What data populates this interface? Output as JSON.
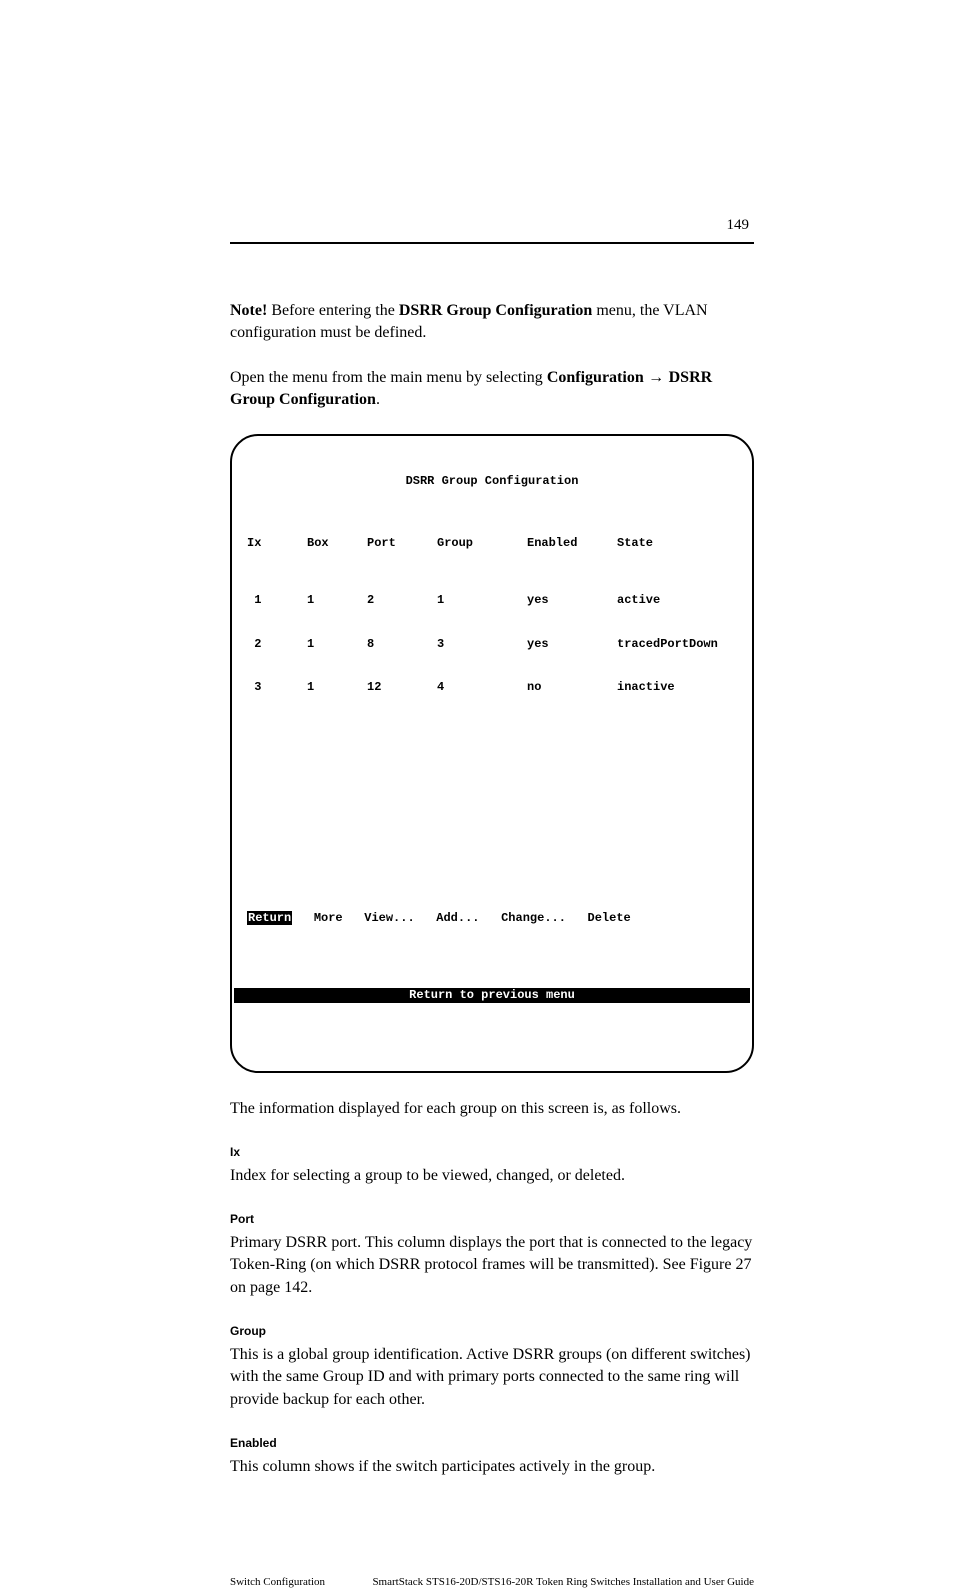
{
  "page_number": "149",
  "intro": {
    "note_label": "Note!",
    "note_pre": " Before entering the ",
    "note_bold": "DSRR Group Configuration",
    "note_post": " menu, the VLAN configuration must be defined."
  },
  "open_menu": {
    "pre": "Open the menu from the main menu by selecting ",
    "b1": "Configuration",
    "arrow": " → ",
    "b2": "DSRR Group Configuration",
    "post": "."
  },
  "terminal": {
    "title": "DSRR Group Configuration",
    "headers": {
      "ix": "Ix",
      "box": "Box",
      "port": "Port",
      "group": "Group",
      "enabled": "Enabled",
      "state": "State"
    },
    "rows": [
      {
        "ix": " 1",
        "box": "1",
        "port": "2",
        "group": "1",
        "enabled": "yes",
        "state": "active"
      },
      {
        "ix": " 2",
        "box": "1",
        "port": "8",
        "group": "3",
        "enabled": "yes",
        "state": "tracedPortDown"
      },
      {
        "ix": " 3",
        "box": "1",
        "port": "12",
        "group": "4",
        "enabled": "no",
        "state": "inactive"
      }
    ],
    "actions": {
      "return": "Return",
      "more": "More",
      "view": "View...",
      "add": "Add...",
      "change": "Change...",
      "delete": "Delete"
    },
    "status": "Return to previous menu"
  },
  "para_after": "The information displayed for each group on this screen is, as follows.",
  "sections": {
    "ix": {
      "heading": "Ix",
      "text": "Index for selecting a group to be viewed, changed, or deleted."
    },
    "port": {
      "heading": "Port",
      "text": "Primary DSRR port. This column displays the port that is connected to the legacy Token-Ring (on which DSRR protocol frames will be transmitted). See Figure 27 on page 142."
    },
    "group": {
      "heading": "Group",
      "text": "This is a global group identification. Active DSRR groups (on different switches) with the same Group ID and with primary ports connected to the same ring will provide backup for each other."
    },
    "enabled": {
      "heading": "Enabled",
      "text": "This column shows if the switch participates actively in the group."
    }
  },
  "footer": {
    "left": "Switch Configuration",
    "right": "SmartStack STS16-20D/STS16-20R Token Ring Switches Installation and User Guide"
  }
}
